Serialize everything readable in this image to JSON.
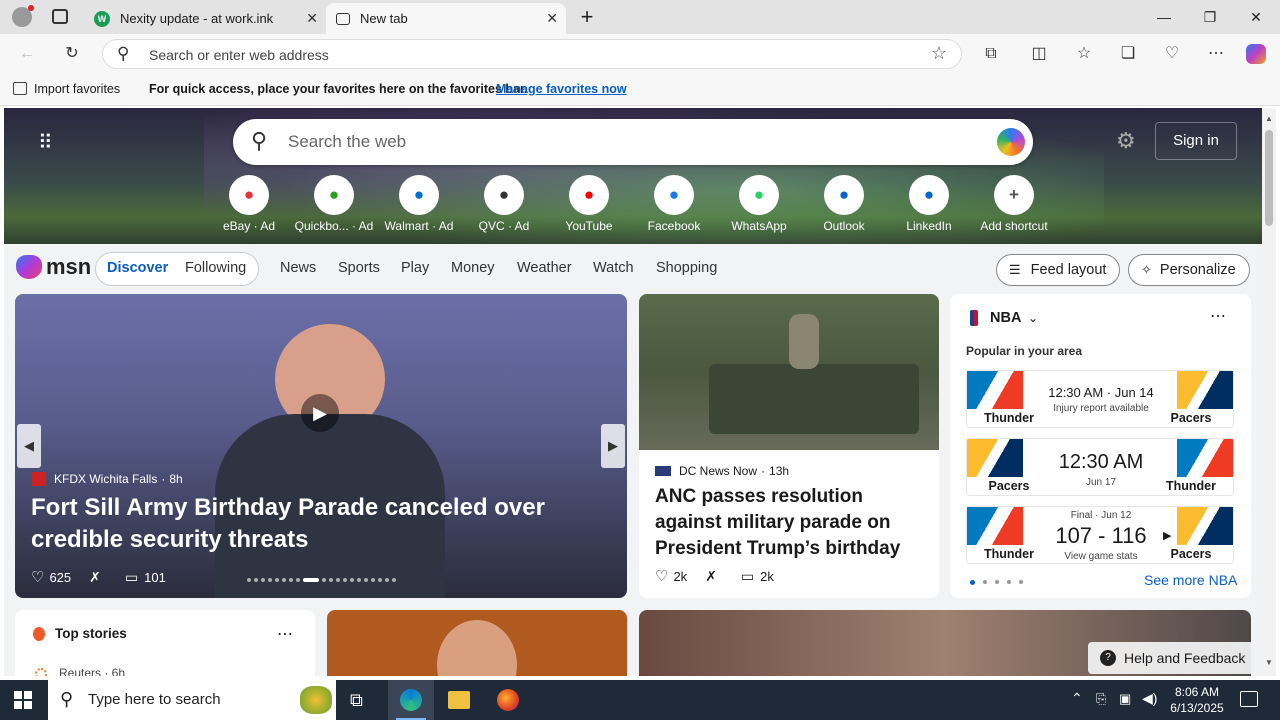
{
  "browser": {
    "tabs": [
      {
        "title": "Nexity update - at work.ink",
        "active": false
      },
      {
        "title": "New tab",
        "active": true
      }
    ],
    "address_placeholder": "Search or enter web address",
    "favorites_bar": {
      "import_label": "Import favorites",
      "message": "For quick access, place your favorites here on the favorites bar.",
      "manage_link": "Manage favorites now"
    }
  },
  "newtab": {
    "search_placeholder": "Search the web",
    "sign_in": "Sign in",
    "shortcuts": [
      {
        "label": "eBay · Ad",
        "icon": "ebay-icon",
        "color": "#e53238"
      },
      {
        "label": "Quickbo... · Ad",
        "icon": "quickbooks-icon",
        "color": "#2ca01c"
      },
      {
        "label": "Walmart · Ad",
        "icon": "walmart-icon",
        "color": "#0071ce"
      },
      {
        "label": "QVC · Ad",
        "icon": "qvc-icon",
        "color": "#333333"
      },
      {
        "label": "YouTube",
        "icon": "youtube-icon",
        "color": "#ff0000"
      },
      {
        "label": "Facebook",
        "icon": "facebook-icon",
        "color": "#1877f2"
      },
      {
        "label": "WhatsApp",
        "icon": "whatsapp-icon",
        "color": "#25d366"
      },
      {
        "label": "Outlook",
        "icon": "outlook-icon",
        "color": "#0a64c8"
      },
      {
        "label": "LinkedIn",
        "icon": "linkedin-icon",
        "color": "#0a66c2"
      },
      {
        "label": "Add shortcut",
        "icon": "plus-icon",
        "color": "#555555"
      }
    ]
  },
  "msn": {
    "logo": "msn",
    "tabs": [
      "Discover",
      "Following"
    ],
    "nav": [
      "News",
      "Sports",
      "Play",
      "Money",
      "Weather",
      "Watch",
      "Shopping"
    ],
    "feed_layout": "Feed layout",
    "personalize": "Personalize"
  },
  "hero_story": {
    "source": "KFDX Wichita Falls",
    "age": "8h",
    "headline": "Fort Sill Army Birthday Parade canceled over credible security threats",
    "likes": "625",
    "comments": "101"
  },
  "side_story": {
    "source": "DC News Now",
    "age": "13h",
    "headline": "ANC passes resolution against military parade on President Trump’s birthday",
    "likes": "2k",
    "comments": "2k"
  },
  "nba": {
    "title": "NBA",
    "subtitle": "Popular in your area",
    "games": [
      {
        "left": "Thunder",
        "right": "Pacers",
        "main": "12:30 AM · Jun 14",
        "sub": "Injury report available"
      },
      {
        "left": "Pacers",
        "right": "Thunder",
        "main": "12:30 AM",
        "sub": "Jun 17"
      },
      {
        "left": "Thunder",
        "right": "Pacers",
        "top": "Final · Jun 12",
        "main": "107 - 116",
        "sub": "View game stats"
      }
    ],
    "see_more": "See more NBA"
  },
  "top_stories": {
    "title": "Top stories",
    "first_source": "Reuters · 6h"
  },
  "help": "Help and Feedback",
  "taskbar": {
    "search_placeholder": "Type here to search",
    "time": "8:06 AM",
    "date": "6/13/2025"
  }
}
